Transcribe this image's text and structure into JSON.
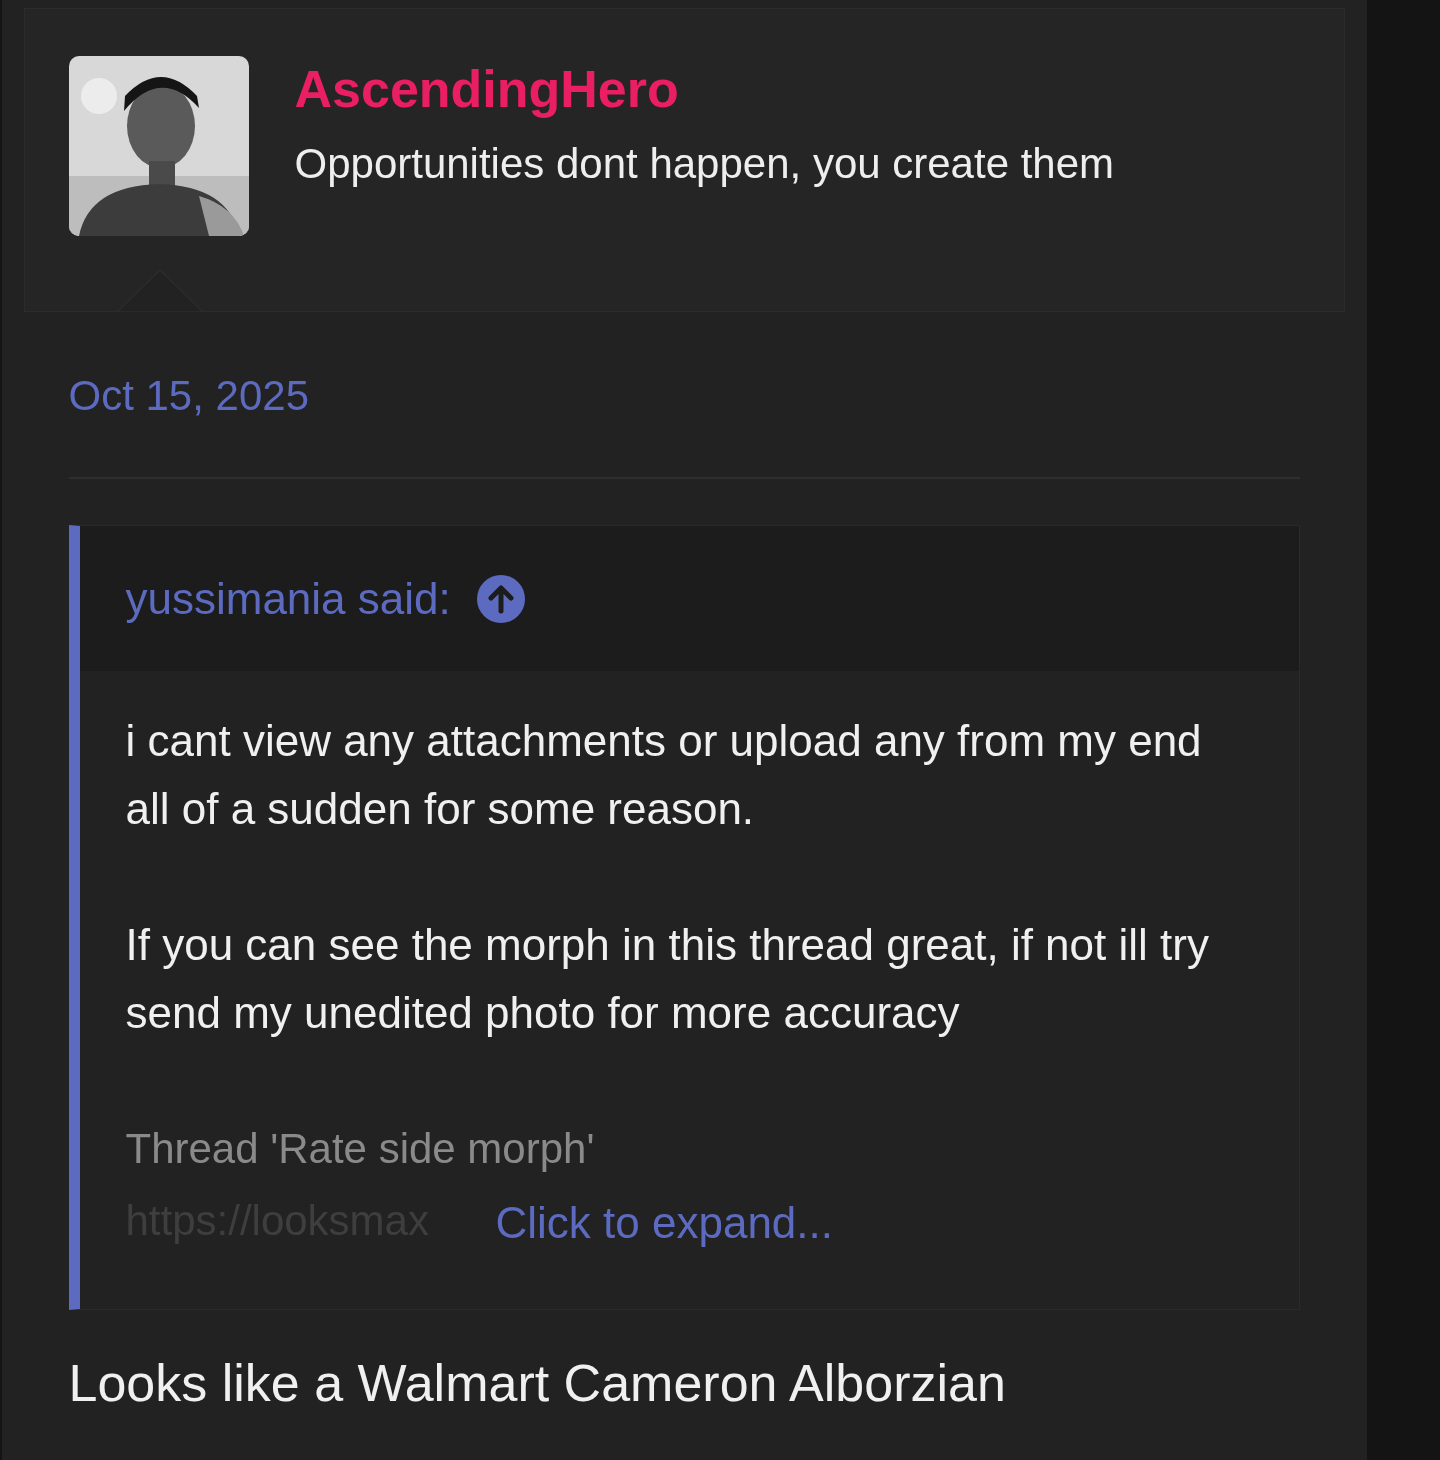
{
  "author": {
    "name": "AscendingHero",
    "tagline": "Opportunities dont happen, you create them"
  },
  "post": {
    "date": "Oct 15, 2025",
    "quote": {
      "attribution": "yussimania said:",
      "paragraphs": [
        "i cant view any attachments or upload any from my end all of a sudden for some reason.",
        "If you can see the morph in this thread great, if not ill try send my unedited photo for more accuracy"
      ],
      "thread_title": "Thread 'Rate side morph'",
      "thread_url": "https://looksmax",
      "expand_link": "Click to expand..."
    },
    "body": "Looks like a Walmart Cameron Alborzian"
  }
}
